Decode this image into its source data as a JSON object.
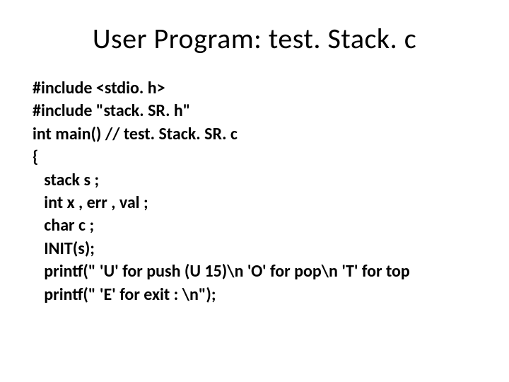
{
  "title": "User Program: test. Stack. c",
  "code": {
    "l1": "#include <stdio. h>",
    "l2": "#include \"stack. SR. h\"",
    "l3": "int main() // test. Stack. SR. c",
    "l4": "{",
    "l5": "   stack s ;",
    "l6": "   int x , err , val ;",
    "l7": "   char c ;",
    "l8": "   INIT(s);",
    "l9": "   printf(\" 'U' for push (U 15)\\n 'O' for pop\\n 'T' for top",
    "l10": "   printf(\" 'E' for exit : \\n\");"
  }
}
